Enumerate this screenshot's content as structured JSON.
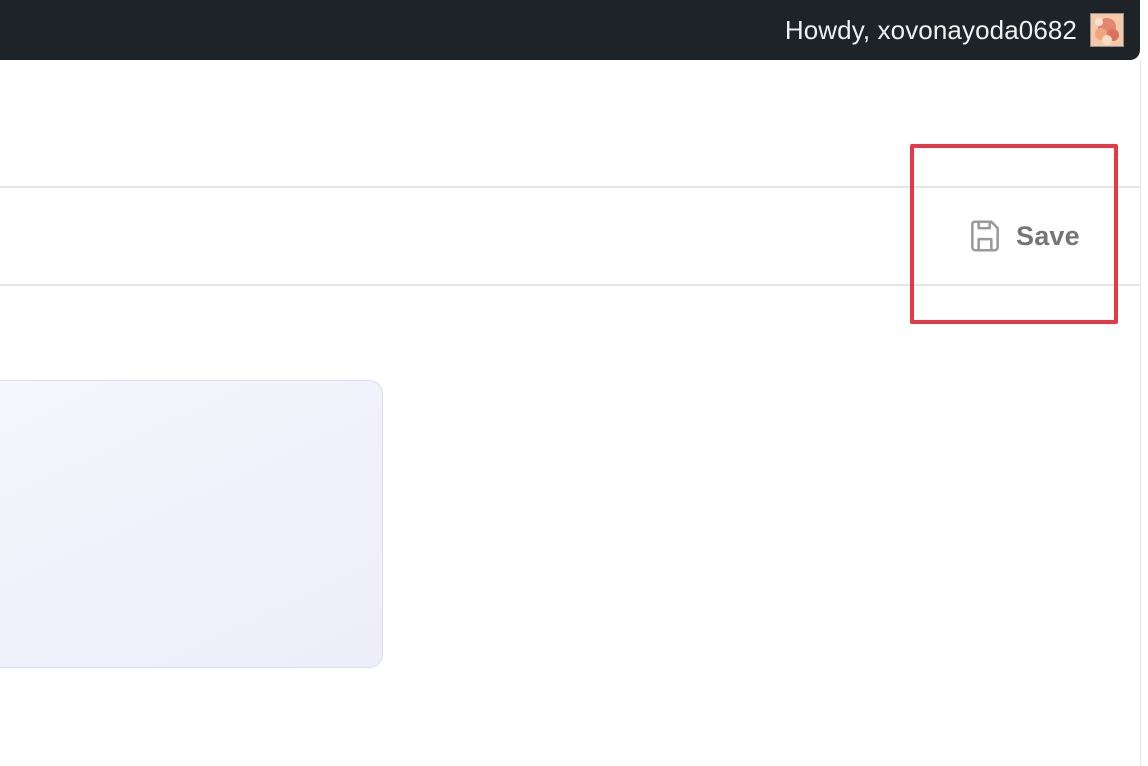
{
  "admin_bar": {
    "greeting": "Howdy, xovonayoda0682",
    "background_color": "#1d2327",
    "avatar_icon": "avatar-image"
  },
  "toolbar": {
    "save_label": "Save",
    "save_icon": "floppy-disk-icon",
    "save_color": "#757575"
  },
  "annotation": {
    "highlight_color": "#e63946"
  },
  "card": {
    "background_color": "#f0f1fb"
  }
}
